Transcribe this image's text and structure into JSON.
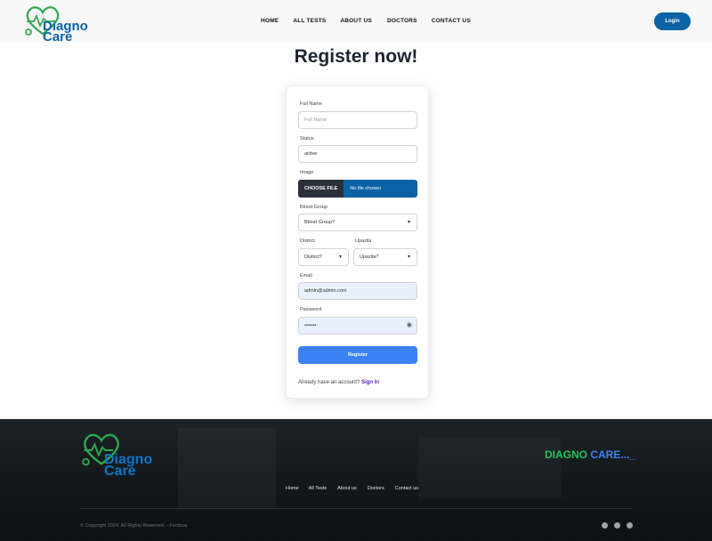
{
  "header": {
    "logo": {
      "line1": "Diagno",
      "line2": "Care"
    },
    "nav": [
      "HOME",
      "ALL TESTS",
      "ABOUT US",
      "DOCTORS",
      "CONTACT US"
    ],
    "login_label": "Login"
  },
  "page_title": "Register now!",
  "form": {
    "full_name": {
      "label": "Full Name",
      "placeholder": "Full Name",
      "value": ""
    },
    "status": {
      "label": "Status",
      "value": "active"
    },
    "image": {
      "label": "Image",
      "button": "CHOOSE FILE",
      "status": "No file chosen"
    },
    "blood_group": {
      "label": "Blood Group",
      "value": "Blood Group?"
    },
    "district": {
      "label": "District",
      "value": "District?"
    },
    "upazila": {
      "label": "Upazila",
      "value": "Upazila?"
    },
    "email": {
      "label": "Email",
      "value": "admin@admin.com"
    },
    "password": {
      "label": "Password",
      "value": "•••••••"
    },
    "register_label": "Register",
    "already_text": "Already have an account?",
    "sign_in_label": "Sign In"
  },
  "footer": {
    "logo": {
      "line1": "Diagno",
      "line2": "Care"
    },
    "brand": {
      "part1": "DIAGNO",
      "part2": "CARE..._"
    },
    "nav": [
      "Home",
      "All Tests",
      "About us",
      "Doctors",
      "Contact us"
    ],
    "copyright": "© Copyright 2024, All Rights Reserved. - Ferdous",
    "social": [
      "dribbble-icon",
      "facebook-icon",
      "github-icon"
    ]
  },
  "colors": {
    "primary": "#0b63a6",
    "register_button": "#3b82f6",
    "brand_green": "#22c55e",
    "sign_in": "#5b21b6"
  }
}
